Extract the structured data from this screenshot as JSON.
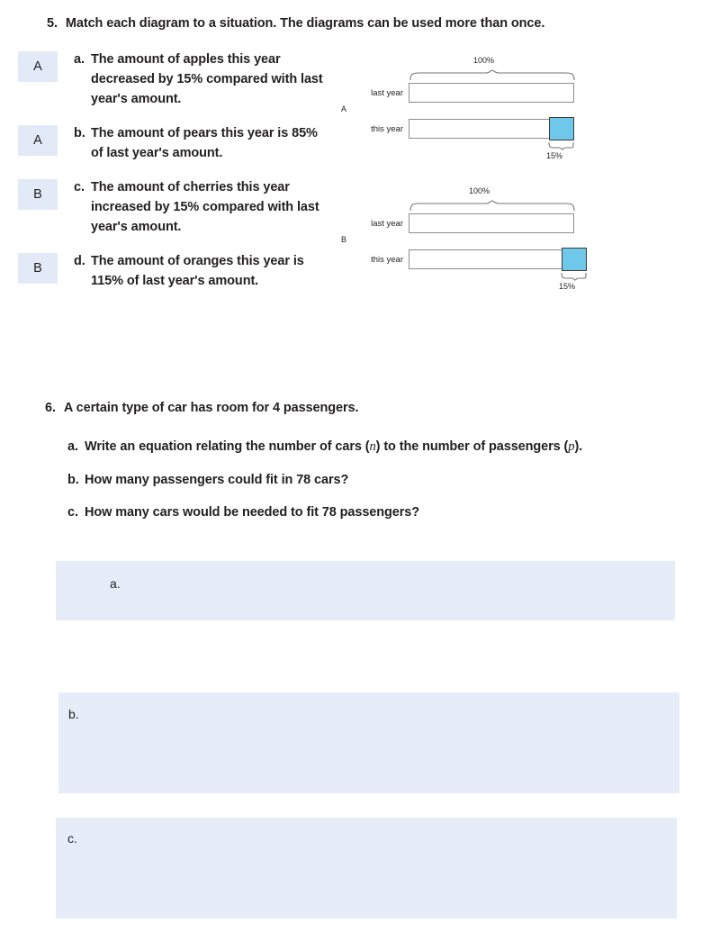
{
  "question5": {
    "number": "5.",
    "prompt": "Match each diagram to a situation. The diagrams can be used more than once.",
    "items": [
      {
        "answer": "A",
        "letter": "a.",
        "text": "The amount of apples this year decreased by 15% compared with last year's amount."
      },
      {
        "answer": "A",
        "letter": "b.",
        "text": "The amount of pears this year is 85% of last year's amount."
      },
      {
        "answer": "B",
        "letter": "c.",
        "text": "The amount of cherries this year increased by 15% compared with last year's amount."
      },
      {
        "answer": "B",
        "letter": "d.",
        "text": "The amount of oranges this year is 115% of last year's amount."
      }
    ],
    "diagrams": [
      {
        "label": "A",
        "top_percent": "100%",
        "segment_percent": "15%",
        "row1_label": "last year",
        "row2_label": "this year"
      },
      {
        "label": "B",
        "top_percent": "100%",
        "segment_percent": "15%",
        "row1_label": "last year",
        "row2_label": "this year"
      }
    ]
  },
  "question6": {
    "number": "6.",
    "prompt": "A certain type of car has room for 4 passengers.",
    "items": [
      {
        "letter": "a.",
        "pre": "Write an equation relating the number of cars (",
        "var1": "n",
        "mid": ") to the number of passengers (",
        "var2": "p",
        "post": ")."
      },
      {
        "letter": "b.",
        "pre": "How many passengers could fit in 78 cars?",
        "var1": "",
        "mid": "",
        "var2": "",
        "post": ""
      },
      {
        "letter": "c.",
        "pre": "How many cars would be needed to fit 78 passengers?",
        "var1": "",
        "mid": "",
        "var2": "",
        "post": ""
      }
    ],
    "answer_boxes": [
      {
        "label": "a.",
        "value": ""
      },
      {
        "label": "b.",
        "value": ""
      },
      {
        "label": "c.",
        "value": ""
      }
    ]
  },
  "colors": {
    "chip_background": "#e3eaf7",
    "answer_box_background": "#e6edf9",
    "bar_fill": "#6fc7e9",
    "bar_border": "#8d8d8d",
    "text": "#231f20"
  }
}
